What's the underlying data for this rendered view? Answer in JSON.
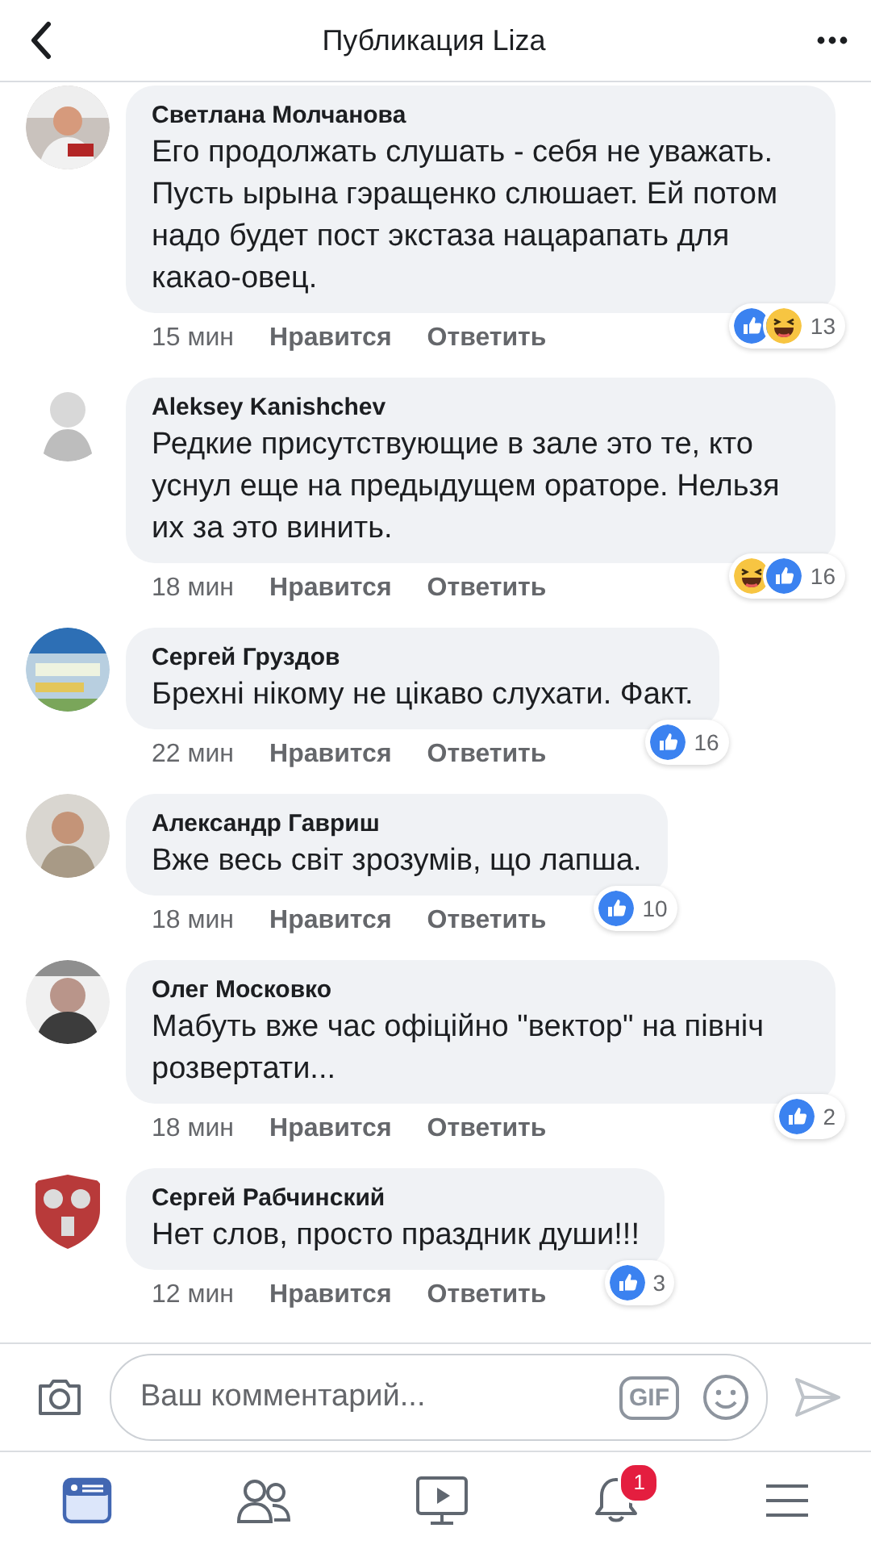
{
  "header": {
    "title": "Публикация Liza"
  },
  "comments": [
    {
      "author": "Светлана Молчанова",
      "text": "Его продолжать слушать - себя не уважать. Пусть ырына гэращенко слюшает. Ей потом надо будет пост экстаза нацарапать для какао-овец.",
      "time": "15 мин",
      "like_label": "Нравится",
      "reply_label": "Ответить",
      "reactions": [
        {
          "kind": "like"
        },
        {
          "kind": "haha"
        }
      ],
      "reaction_count": "13"
    },
    {
      "author": "Aleksey Kanishchev",
      "text": "Редкие присутствующие в зале это те, кто уснул еще на предыдущем ораторе. Нельзя их за это винить.",
      "time": "18 мин",
      "like_label": "Нравится",
      "reply_label": "Ответить",
      "reactions": [
        {
          "kind": "haha"
        },
        {
          "kind": "like"
        }
      ],
      "reaction_count": "16"
    },
    {
      "author": "Сергей Груздов",
      "text": "Брехні нікому не цікаво слухати. Факт.",
      "time": "22 мин",
      "like_label": "Нравится",
      "reply_label": "Ответить",
      "reactions": [
        {
          "kind": "like"
        }
      ],
      "reaction_count": "16"
    },
    {
      "author": "Александр Гавриш",
      "text": "Вже весь світ зрозумів, що лапша.",
      "time": "18 мин",
      "like_label": "Нравится",
      "reply_label": "Ответить",
      "reactions": [
        {
          "kind": "like"
        }
      ],
      "reaction_count": "10"
    },
    {
      "author": "Олег Московко",
      "text": "Мабуть вже час офіційно \"вектор\" на північ розвертати...",
      "time": "18 мин",
      "like_label": "Нравится",
      "reply_label": "Ответить",
      "reactions": [
        {
          "kind": "like"
        }
      ],
      "reaction_count": "2"
    },
    {
      "author": "Сергей Рабчинский",
      "text": "Нет слов, просто праздник души!!!",
      "time": "12 мин",
      "like_label": "Нравится",
      "reply_label": "Ответить",
      "reactions": [
        {
          "kind": "like"
        }
      ],
      "reaction_count": "3"
    }
  ],
  "composer": {
    "placeholder": "Ваш комментарий...",
    "gif_label": "GIF"
  },
  "tabs": [
    {
      "kind": "feed",
      "selected": true
    },
    {
      "kind": "friends",
      "selected": false
    },
    {
      "kind": "video",
      "selected": false
    },
    {
      "kind": "notifications",
      "selected": false,
      "badge": "1"
    },
    {
      "kind": "menu",
      "selected": false
    }
  ]
}
